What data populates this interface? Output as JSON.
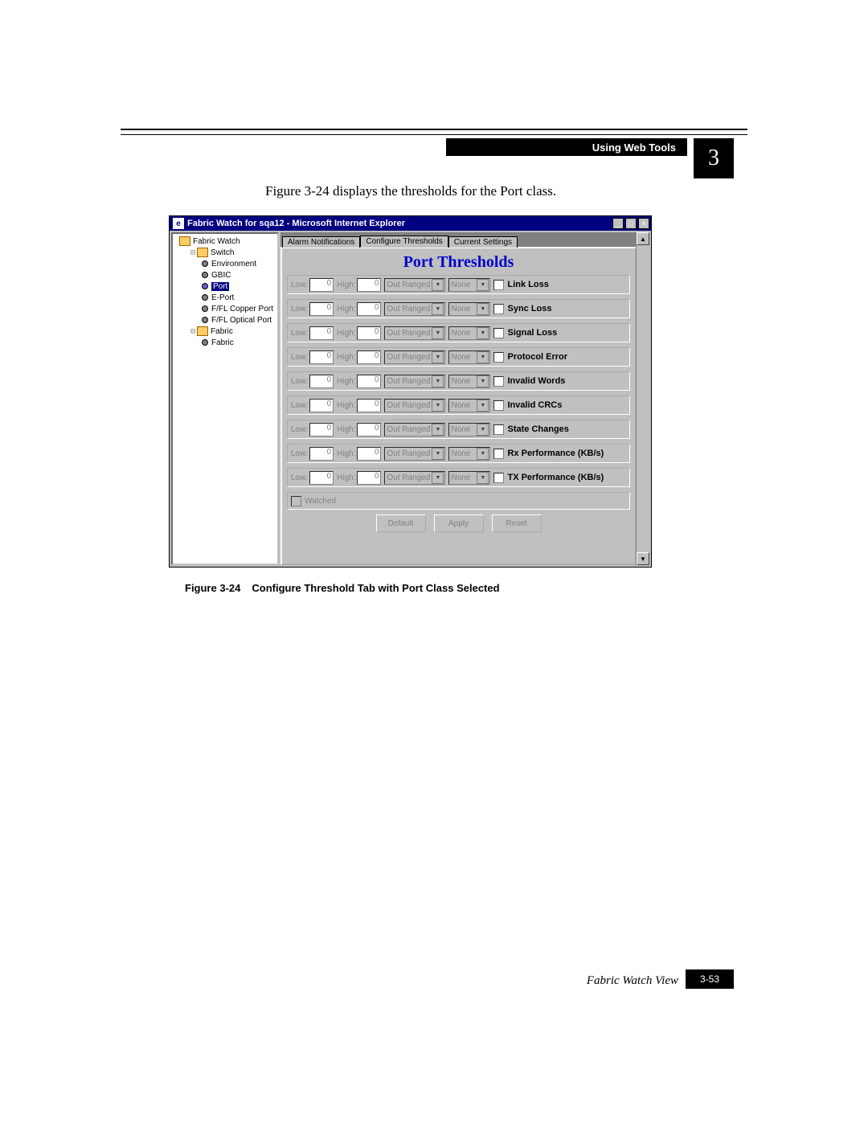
{
  "header": {
    "section": "Using Web Tools",
    "chapter": "3"
  },
  "intro": "Figure 3-24 displays the thresholds for the Port class.",
  "figure": {
    "num": "Figure 3-24",
    "caption": "Configure Threshold Tab with Port Class Selected"
  },
  "footer": {
    "label": "Fabric Watch View",
    "page": "3-53"
  },
  "window": {
    "title": "Fabric Watch for sqa12 - Microsoft Internet Explorer",
    "ie_glyph": "e",
    "min": "_",
    "max": "□",
    "close": "×",
    "scroll_up": "▲",
    "scroll_dn": "▼"
  },
  "tree": {
    "root": "Fabric Watch",
    "switch": "Switch",
    "env": "Environment",
    "gbic": "GBIC",
    "port": "Port",
    "eport": "E-Port",
    "ffl_cu": "F/FL Copper Port",
    "ffl_op": "F/FL Optical Port",
    "fabric": "Fabric",
    "fabric2": "Fabric"
  },
  "tabs": {
    "alarm": "Alarm Notifications",
    "conf": "Configure Thresholds",
    "cur": "Current Settings"
  },
  "panel": {
    "title": "Port Thresholds",
    "low_label": "Low:",
    "high_label": "High:",
    "low_val": "0",
    "high_val": "0",
    "range": "Out Ranged",
    "none": "None",
    "rows": {
      "link_loss": "Link Loss",
      "sync_loss": "Sync Loss",
      "signal_loss": "Signal Loss",
      "protocol_error": "Protocol Error",
      "invalid_words": "Invalid Words",
      "invalid_crcs": "Invalid CRCs",
      "state_changes": "State Changes",
      "rx_perf": "Rx Performance (KB/s)",
      "tx_perf": "TX Performance (KB/s)"
    },
    "watched": "Watched",
    "buttons": {
      "default": "Default",
      "apply": "Apply",
      "reset": "Reset"
    }
  }
}
